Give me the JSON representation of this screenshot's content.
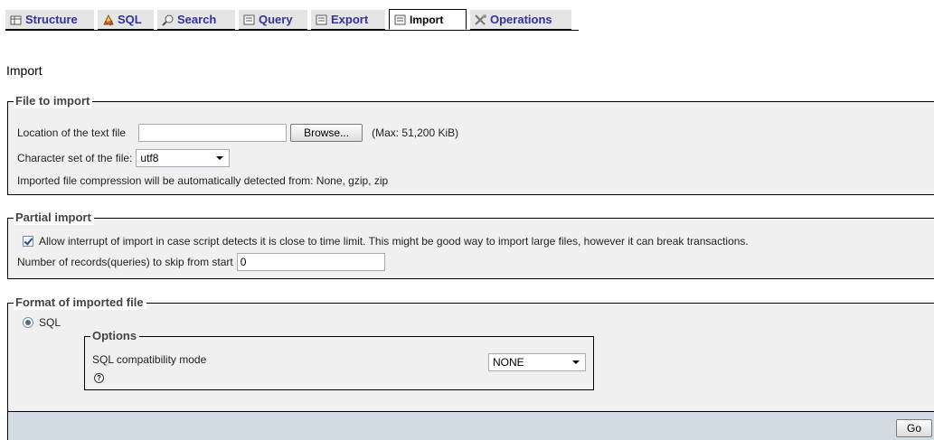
{
  "tabs": [
    {
      "label": "Structure",
      "icon": "structure-icon"
    },
    {
      "label": "SQL",
      "icon": "sql-icon"
    },
    {
      "label": "Search",
      "icon": "search-icon"
    },
    {
      "label": "Query",
      "icon": "query-icon"
    },
    {
      "label": "Export",
      "icon": "export-icon"
    },
    {
      "label": "Import",
      "icon": "import-icon",
      "active": true
    },
    {
      "label": "Operations",
      "icon": "operations-icon"
    }
  ],
  "page_title": "Import",
  "file_to_import": {
    "legend": "File to import",
    "location_label": "Location of the text file",
    "browse_label": "Browse...",
    "max_size": "(Max: 51,200 KiB)",
    "charset_label": "Character set of the file:",
    "charset_value": "utf8",
    "compression_note": "Imported file compression will be automatically detected from: None, gzip, zip"
  },
  "partial_import": {
    "legend": "Partial import",
    "allow_interrupt_label": "Allow interrupt of import in case script detects it is close to time limit. This might be good way to import large files, however it can break transactions.",
    "allow_interrupt_checked": true,
    "skip_label": "Number of records(queries) to skip from start",
    "skip_value": "0"
  },
  "format": {
    "legend": "Format of imported file",
    "sql_label": "SQL",
    "options_legend": "Options",
    "compat_label": "SQL compatibility mode",
    "compat_value": "NONE"
  },
  "go_label": "Go",
  "colors": {
    "tab_text": "#333399",
    "fieldset_bg": "#f0f0f0",
    "go_bar_bg": "#d3dce3"
  }
}
